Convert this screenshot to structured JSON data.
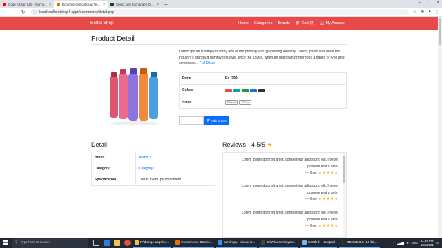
{
  "browser": {
    "tabs": [
      {
        "title": "Code Artisan Lab - YouTube",
        "color": "#ff0000"
      },
      {
        "title": "Ecommerce Bootstrap Template",
        "color": "#e8710a",
        "active": true
      },
      {
        "title": "Select size to change | Django a",
        "color": "#0c4b33"
      }
    ],
    "url": "localhost/bootstrap4-apps/ecommerce/detail.php"
  },
  "navbar": {
    "brand": "Bottle Shop",
    "links": [
      "Home",
      "Categories",
      "Brands",
      "Cart (2)",
      "My Account"
    ]
  },
  "product": {
    "title": "Product Detail",
    "description": "Lorem Ipsum is simply dummy text of the printing and typesetting industry. Lorem Ipsum has been the industry's standard dummy text ever since the 1500s, when an unknown printer took a galley of type and scrambled...",
    "full_detail_link": "Full Detail",
    "price_label": "Price",
    "price_value": "Rs. 299",
    "colors_label": "Colors",
    "colors": [
      "#e84a4a",
      "#1a9bb0",
      "#1e9c3c",
      "#1e6fe0",
      "#333333"
    ],
    "sizes_label": "Sizes",
    "sizes": [
      "500 ml",
      "100 ml"
    ],
    "add_to_cart": "Add to Cart"
  },
  "detail": {
    "title": "Detail",
    "rows": [
      {
        "key": "Brand",
        "value": "Brand 1",
        "link": true
      },
      {
        "key": "Category",
        "value": "Category 1",
        "link": true
      },
      {
        "key": "Specification",
        "value": "This is lorem ipsum content",
        "link": false
      }
    ]
  },
  "reviews": {
    "title": "Reviews - 4.5/5",
    "items": [
      {
        "line1": "Lorem ipsum dolor sit amet, consectetur adipisicing elit. Integer",
        "line2": "posuere erat a ante.",
        "by": "— User",
        "stars": "★★★★★"
      },
      {
        "line1": "Lorem ipsum dolor sit amet, consectetur adipisicing elit. Integer",
        "line2": "posuere erat a ante.",
        "by": "— User",
        "stars": "★★★★★"
      },
      {
        "line1": "Lorem ipsum dolor sit amet, consectetur adipisicing elit. Integer",
        "line2": "posuere erat a ante.",
        "by": "— User",
        "stars": "★★★★★"
      }
    ]
  },
  "taskbar": {
    "search_placeholder": "Type here to search",
    "apps": [
      {
        "label": "F:\\django-apps\\ec...",
        "color": "#f2c14e"
      },
      {
        "label": "Ecommerce Bootst...",
        "color": "#e8710a"
      },
      {
        "label": "admin.py - Visual S...",
        "color": "#3b8eea"
      },
      {
        "label": "C:\\Windows\\Syste...",
        "color": "#444444"
      },
      {
        "label": "Untitled - Notepad",
        "color": "#7fb2e5"
      },
      {
        "label": "OBS 25.0.8 (64-bit,...",
        "color": "#302e31"
      }
    ],
    "lang": "ENG",
    "time": "11:39 PM",
    "date": "1/31/2021"
  }
}
